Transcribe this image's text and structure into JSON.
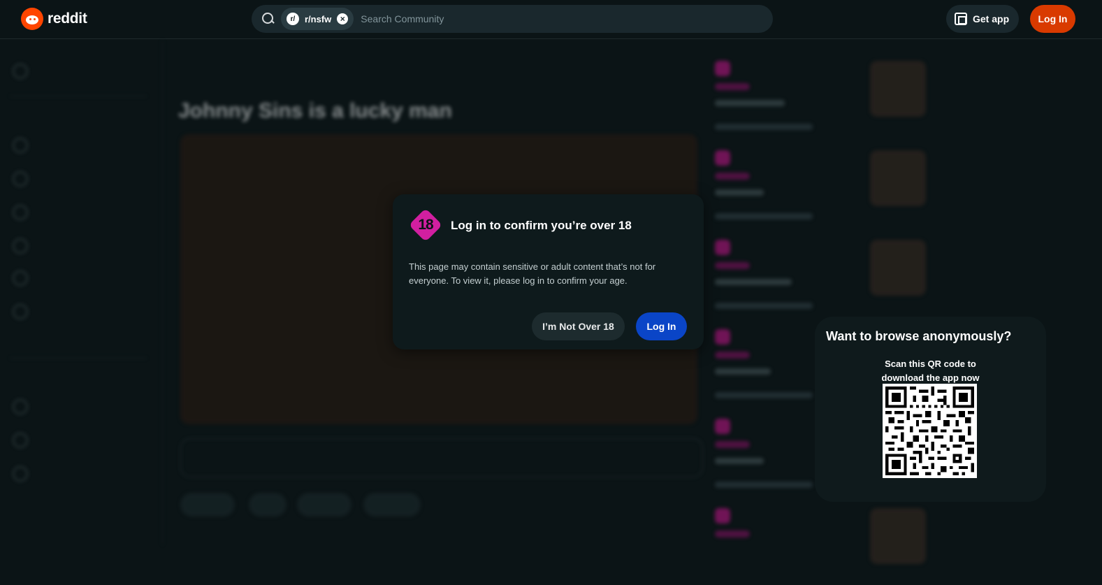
{
  "header": {
    "logo_text": "reddit",
    "search": {
      "community_chip": "r/nsfw",
      "chip_badge": "r/",
      "placeholder": "Search Community"
    },
    "get_app_label": "Get app",
    "login_label": "Log In"
  },
  "post": {
    "title": "Johnny Sins is a lucky man"
  },
  "modal": {
    "badge": "18",
    "title": "Log in to confirm you’re over 18",
    "body": "This page may contain sensitive or adult content that’s not for everyone. To view it, please log in to confirm your age.",
    "not_over_label": "I’m Not Over 18",
    "login_label": "Log In"
  },
  "qr_panel": {
    "title": "Want to browse anonymously?",
    "subtitle_line1": "Scan this QR code to",
    "subtitle_line2": "download the app now"
  },
  "colors": {
    "background": "#0b1416",
    "brand_orange": "#ff4500",
    "login_orange": "#d93a00",
    "login_blue": "#0a45c7",
    "nsfw_pink": "#d11fa0"
  }
}
